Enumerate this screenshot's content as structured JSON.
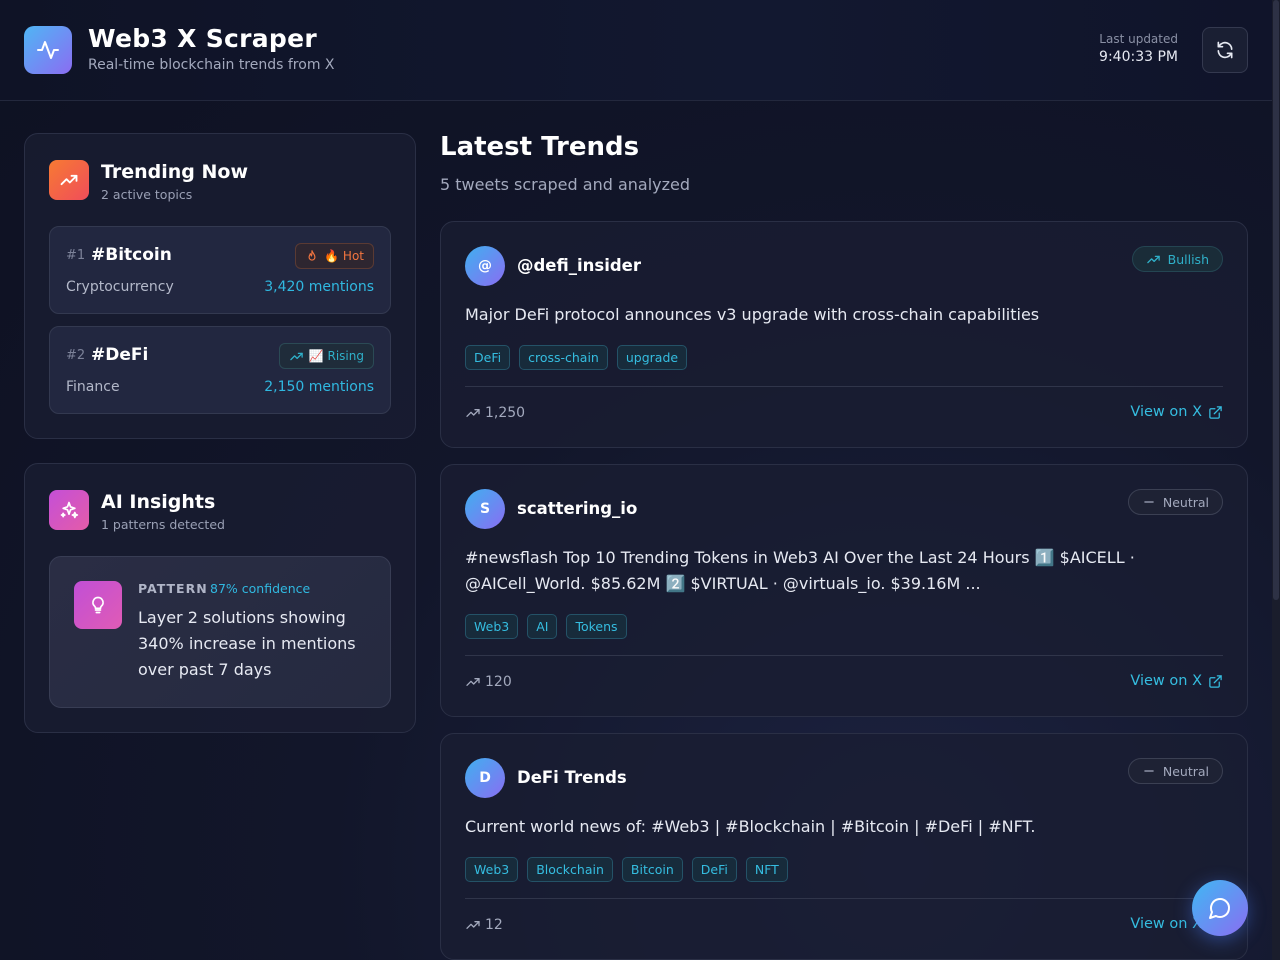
{
  "header": {
    "title": "Web3 X Scraper",
    "subtitle": "Real-time blockchain trends from X",
    "last_updated_label": "Last updated",
    "last_updated_time": "9:40:33 PM",
    "logo_icon": "activity-icon",
    "refresh_icon": "refresh-icon"
  },
  "trending": {
    "title": "Trending Now",
    "subtitle": "2 active topics",
    "items": [
      {
        "rank": "#1",
        "tag": "#Bitcoin",
        "category": "Cryptocurrency",
        "mentions": "3,420 mentions",
        "badge": "🔥 Hot",
        "badge_icon": "flame-icon"
      },
      {
        "rank": "#2",
        "tag": "#DeFi",
        "category": "Finance",
        "mentions": "2,150 mentions",
        "badge": "📈 Rising",
        "badge_icon": "trending-up-icon"
      }
    ]
  },
  "insights": {
    "title": "AI Insights",
    "subtitle": "1 patterns detected",
    "pattern_label": "PATTERN",
    "confidence": "87% confidence",
    "text": "Layer 2 solutions showing 340% increase in mentions over past 7 days"
  },
  "main": {
    "title": "Latest Trends",
    "subtitle": "5 tweets scraped and analyzed",
    "view_label": "View on X",
    "tweets": [
      {
        "initial": "@",
        "author": "@defi_insider",
        "sentiment": "Bullish",
        "text": "Major DeFi protocol announces v3 upgrade with cross-chain capabilities",
        "tags": [
          "DeFi",
          "cross-chain",
          "upgrade"
        ],
        "engagement": "1,250"
      },
      {
        "initial": "S",
        "author": "scattering_io",
        "sentiment": "Neutral",
        "text": "#newsflash Top 10 Trending Tokens in Web3 AI Over the Last 24 Hours 1️⃣ $AICELL · @AICell_World. $85.62M 2️⃣ $VIRTUAL · @virtuals_io. $39.16M ...",
        "tags": [
          "Web3",
          "AI",
          "Tokens"
        ],
        "engagement": "120"
      },
      {
        "initial": "D",
        "author": "DeFi Trends",
        "sentiment": "Neutral",
        "text": "Current world news of: #Web3 | #Blockchain | #Bitcoin | #DeFi | #NFT.",
        "tags": [
          "Web3",
          "Blockchain",
          "Bitcoin",
          "DeFi",
          "NFT"
        ],
        "engagement": "12"
      }
    ]
  },
  "colors": {
    "accent": "#35bde0",
    "hot": "#f2753f",
    "background": "#12162a"
  }
}
